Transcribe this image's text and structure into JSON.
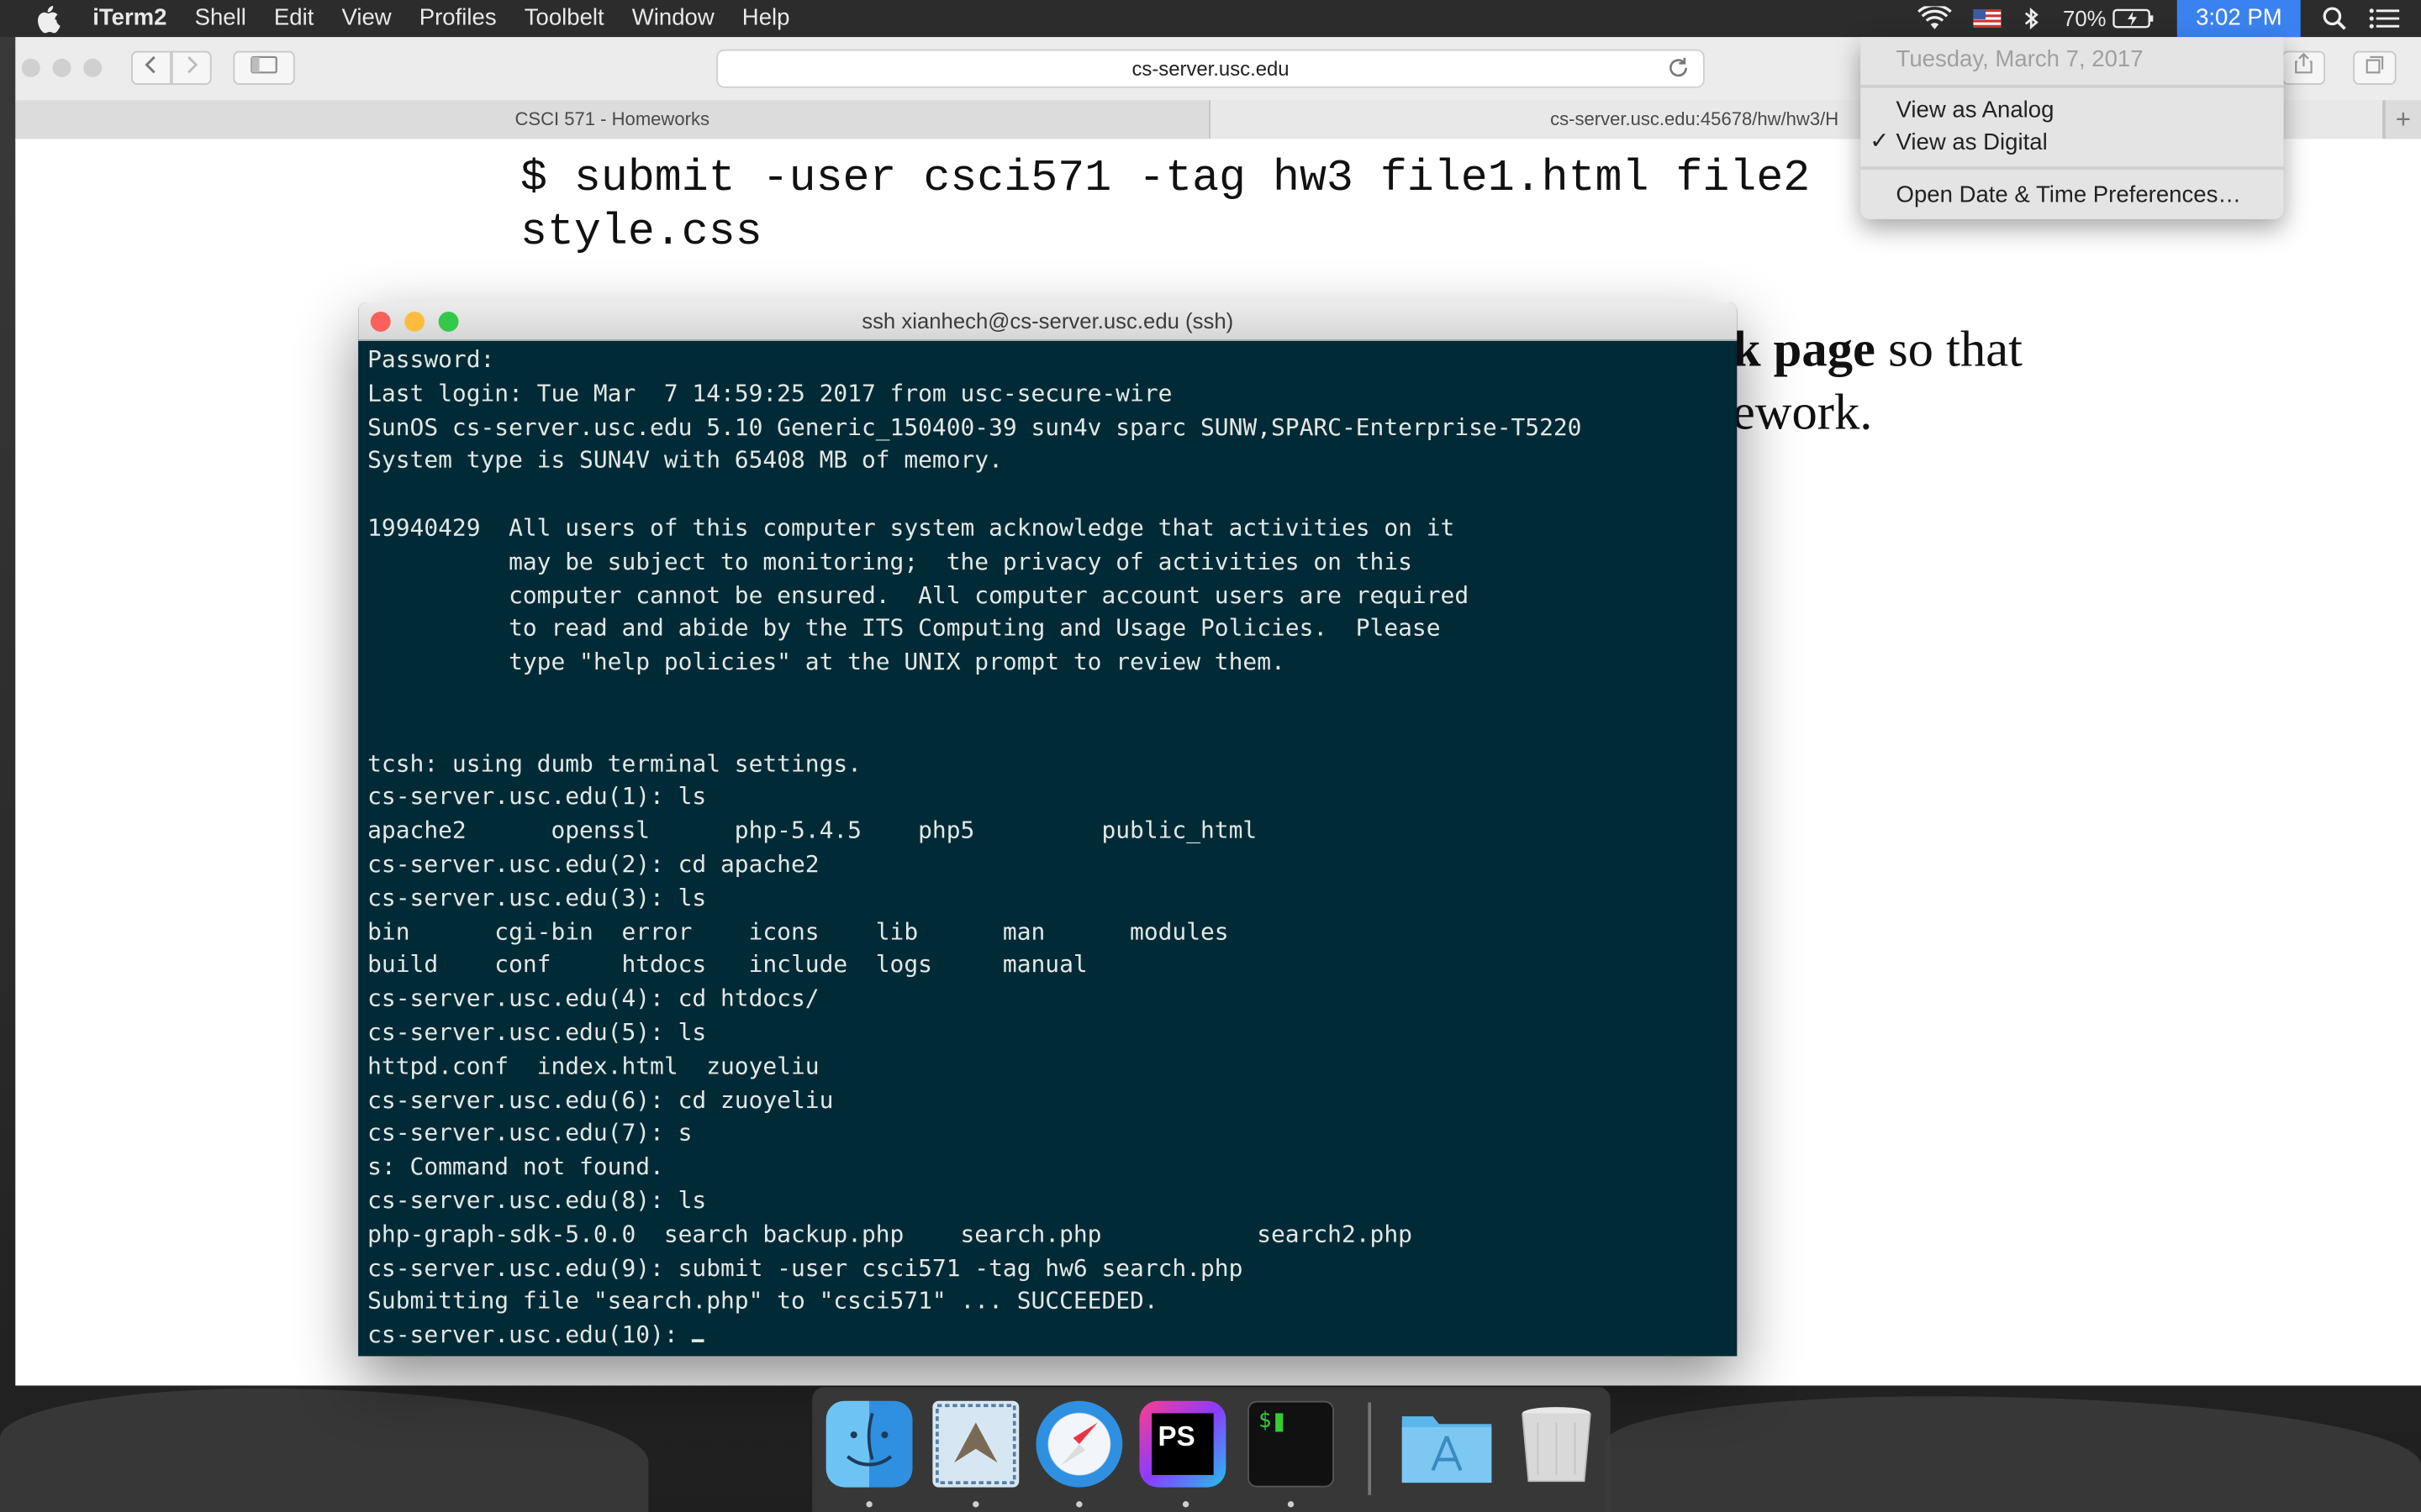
{
  "menubar": {
    "app_name": "iTerm2",
    "items": [
      "Shell",
      "Edit",
      "View",
      "Profiles",
      "Toolbelt",
      "Window",
      "Help"
    ],
    "battery_pct": "70%",
    "clock": "3:02 PM",
    "icons": [
      "apple-icon",
      "wifi-icon",
      "flag-icon",
      "bluetooth-icon",
      "battery-icon",
      "spotlight-icon",
      "notification-center-icon"
    ]
  },
  "clock_menu": {
    "date": "Tuesday, March 7, 2017",
    "view_analog": "View as Analog",
    "view_digital": "View as Digital",
    "checked": "✓",
    "preferences": "Open Date & Time Preferences…"
  },
  "safari": {
    "url": "cs-server.usc.edu",
    "tabs": [
      {
        "label": "CSCI 571 - Homeworks"
      },
      {
        "label": "cs-server.usc.edu:45678/hw/hw3/H"
      }
    ],
    "add_tab": "+",
    "page": {
      "command_lines": [
        "$ submit -user csci571 -tag hw3 file1.html file2",
        "style.css"
      ],
      "body_line1_bold": "k page",
      "body_line1_rest": " so that",
      "body_line2": "ework."
    }
  },
  "terminal": {
    "title": "ssh xianhech@cs-server.usc.edu (ssh)",
    "lines": [
      "Password:",
      "Last login: Tue Mar  7 14:59:25 2017 from usc-secure-wire",
      "SunOS cs-server.usc.edu 5.10 Generic_150400-39 sun4v sparc SUNW,SPARC-Enterprise-T5220",
      "System type is SUN4V with 65408 MB of memory.",
      "",
      "19940429  All users of this computer system acknowledge that activities on it",
      "          may be subject to monitoring;  the privacy of activities on this",
      "          computer cannot be ensured.  All computer account users are required",
      "          to read and abide by the ITS Computing and Usage Policies.  Please",
      "          type \"help policies\" at the UNIX prompt to review them.",
      "",
      "",
      "tcsh: using dumb terminal settings.",
      "cs-server.usc.edu(1): ls",
      "apache2      openssl      php-5.4.5    php5         public_html",
      "cs-server.usc.edu(2): cd apache2",
      "cs-server.usc.edu(3): ls",
      "bin      cgi-bin  error    icons    lib      man      modules",
      "build    conf     htdocs   include  logs     manual",
      "cs-server.usc.edu(4): cd htdocs/",
      "cs-server.usc.edu(5): ls",
      "httpd.conf  index.html  zuoyeliu",
      "cs-server.usc.edu(6): cd zuoyeliu",
      "cs-server.usc.edu(7): s",
      "s: Command not found.",
      "cs-server.usc.edu(8): ls",
      "php-graph-sdk-5.0.0  search backup.php    search.php           search2.php",
      "cs-server.usc.edu(9): submit -user csci571 -tag hw6 search.php",
      "Submitting file \"search.php\" to \"csci571\" ... SUCCEEDED.",
      "cs-server.usc.edu(10): "
    ]
  },
  "dock": {
    "apps": [
      {
        "name": "finder-icon",
        "running": true
      },
      {
        "name": "mail-icon",
        "running": true
      },
      {
        "name": "safari-icon",
        "running": true
      },
      {
        "name": "phpstorm-icon",
        "running": true,
        "label": "PS"
      },
      {
        "name": "iterm-icon",
        "running": true,
        "label": "$"
      },
      {
        "name": "applications-folder-icon",
        "running": false
      },
      {
        "name": "trash-icon",
        "running": false
      }
    ]
  },
  "colors": {
    "terminal_bg": "#002b36",
    "terminal_fg": "#e3e7e6",
    "clock_highlight": "#3b82f1",
    "close": "#fc605c",
    "minimize": "#fdbc40",
    "zoom": "#34c84a"
  }
}
